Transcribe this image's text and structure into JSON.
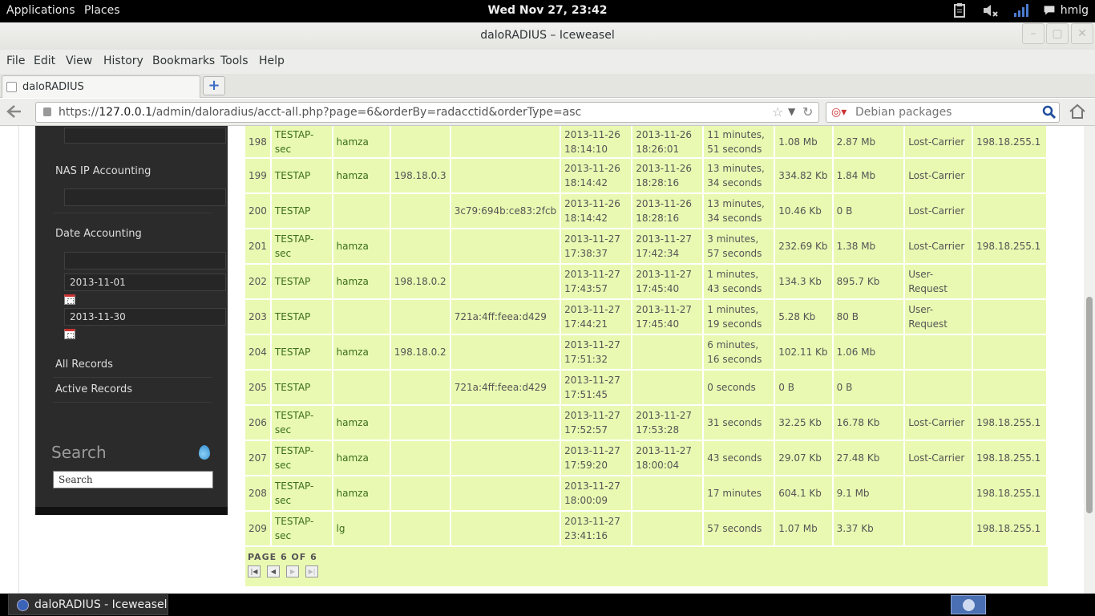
{
  "topbar": {
    "applications": "Applications",
    "places": "Places",
    "clock": "Wed Nov 27, 23:42",
    "user": "hmlg",
    "icons": [
      "clipboard-icon",
      "volume-muted-icon",
      "network-signal-icon",
      "chat-icon"
    ]
  },
  "window": {
    "title": "daloRADIUS – Iceweasel",
    "minimize": "–",
    "maximize": "▢",
    "close": "✕"
  },
  "menubar": {
    "items": [
      "File",
      "Edit",
      "View",
      "History",
      "Bookmarks",
      "Tools",
      "Help"
    ]
  },
  "tabbar": {
    "tab_label": "daloRADIUS",
    "new_tab": "+"
  },
  "navbar": {
    "url_prefix": "https://",
    "url_host": "127.0.0.1",
    "url_path": "/admin/daloradius/acct-all.php?page=6&orderBy=radacctid&orderType=asc",
    "search_placeholder": "Debian packages"
  },
  "sidebar": {
    "nas_ip_label": "NAS IP Accounting",
    "date_label": "Date Accounting",
    "date_from": "2013-11-01",
    "date_to": "2013-11-30",
    "all_records": "All Records",
    "active_records": "Active Records",
    "search_title": "Search",
    "search_value": "Search"
  },
  "table": {
    "rows": [
      {
        "id": "198",
        "hotspot": "TESTAP-sec",
        "user": "hamza",
        "ip": "",
        "mac": "",
        "start": "2013-11-26\n18:14:10",
        "stop": "2013-11-26\n18:26:01",
        "time": "11 minutes,\n51 seconds",
        "upload": "1.08 Mb",
        "download": "2.87 Mb",
        "term": "Lost-Carrier",
        "nas": "198.18.255.1"
      },
      {
        "id": "199",
        "hotspot": "TESTAP",
        "user": "hamza",
        "ip": "198.18.0.3",
        "mac": "",
        "start": "2013-11-26\n18:14:42",
        "stop": "2013-11-26\n18:28:16",
        "time": "13 minutes,\n34 seconds",
        "upload": "334.82 Kb",
        "download": "1.84 Mb",
        "term": "Lost-Carrier",
        "nas": ""
      },
      {
        "id": "200",
        "hotspot": "TESTAP",
        "user": "",
        "ip": "",
        "mac": "3c79:694b:ce83:2fcb",
        "start": "2013-11-26\n18:14:42",
        "stop": "2013-11-26\n18:28:16",
        "time": "13 minutes,\n34 seconds",
        "upload": "10.46 Kb",
        "download": "0 B",
        "term": "Lost-Carrier",
        "nas": ""
      },
      {
        "id": "201",
        "hotspot": "TESTAP-sec",
        "user": "hamza",
        "ip": "",
        "mac": "",
        "start": "2013-11-27\n17:38:37",
        "stop": "2013-11-27\n17:42:34",
        "time": "3 minutes,\n57 seconds",
        "upload": "232.69 Kb",
        "download": "1.38 Mb",
        "term": "Lost-Carrier",
        "nas": "198.18.255.1"
      },
      {
        "id": "202",
        "hotspot": "TESTAP",
        "user": "hamza",
        "ip": "198.18.0.2",
        "mac": "",
        "start": "2013-11-27\n17:43:57",
        "stop": "2013-11-27\n17:45:40",
        "time": "1 minutes,\n43 seconds",
        "upload": "134.3 Kb",
        "download": "895.7 Kb",
        "term": "User-Request",
        "nas": ""
      },
      {
        "id": "203",
        "hotspot": "TESTAP",
        "user": "",
        "ip": "",
        "mac": "721a:4ff:feea:d429",
        "start": "2013-11-27\n17:44:21",
        "stop": "2013-11-27\n17:45:40",
        "time": "1 minutes,\n19 seconds",
        "upload": "5.28 Kb",
        "download": "80 B",
        "term": "User-Request",
        "nas": ""
      },
      {
        "id": "204",
        "hotspot": "TESTAP",
        "user": "hamza",
        "ip": "198.18.0.2",
        "mac": "",
        "start": "2013-11-27\n17:51:32",
        "stop": "",
        "time": "6 minutes,\n16 seconds",
        "upload": "102.11 Kb",
        "download": "1.06 Mb",
        "term": "",
        "nas": ""
      },
      {
        "id": "205",
        "hotspot": "TESTAP",
        "user": "",
        "ip": "",
        "mac": "721a:4ff:feea:d429",
        "start": "2013-11-27\n17:51:45",
        "stop": "",
        "time": "0 seconds",
        "upload": "0 B",
        "download": "0 B",
        "term": "",
        "nas": ""
      },
      {
        "id": "206",
        "hotspot": "TESTAP-sec",
        "user": "hamza",
        "ip": "",
        "mac": "",
        "start": "2013-11-27\n17:52:57",
        "stop": "2013-11-27\n17:53:28",
        "time": "31 seconds",
        "upload": "32.25 Kb",
        "download": "16.78 Kb",
        "term": "Lost-Carrier",
        "nas": "198.18.255.1"
      },
      {
        "id": "207",
        "hotspot": "TESTAP-sec",
        "user": "hamza",
        "ip": "",
        "mac": "",
        "start": "2013-11-27\n17:59:20",
        "stop": "2013-11-27\n18:00:04",
        "time": "43 seconds",
        "upload": "29.07 Kb",
        "download": "27.48 Kb",
        "term": "Lost-Carrier",
        "nas": "198.18.255.1"
      },
      {
        "id": "208",
        "hotspot": "TESTAP-sec",
        "user": "hamza",
        "ip": "",
        "mac": "",
        "start": "2013-11-27\n18:00:09",
        "stop": "",
        "time": "17 minutes",
        "upload": "604.1 Kb",
        "download": "9.1 Mb",
        "term": "",
        "nas": "198.18.255.1"
      },
      {
        "id": "209",
        "hotspot": "TESTAP-sec",
        "user": "lg",
        "ip": "",
        "mac": "",
        "start": "2013-11-27\n23:41:16",
        "stop": "",
        "time": "57 seconds",
        "upload": "1.07 Mb",
        "download": "3.37 Kb",
        "term": "",
        "nas": "198.18.255.1"
      }
    ],
    "pager": "PAGE 6 OF 6",
    "pager_buttons": [
      "first-page",
      "prev-page",
      "next-page",
      "last-page"
    ]
  },
  "taskbar": {
    "item_label": "daloRADIUS - Iceweasel"
  }
}
